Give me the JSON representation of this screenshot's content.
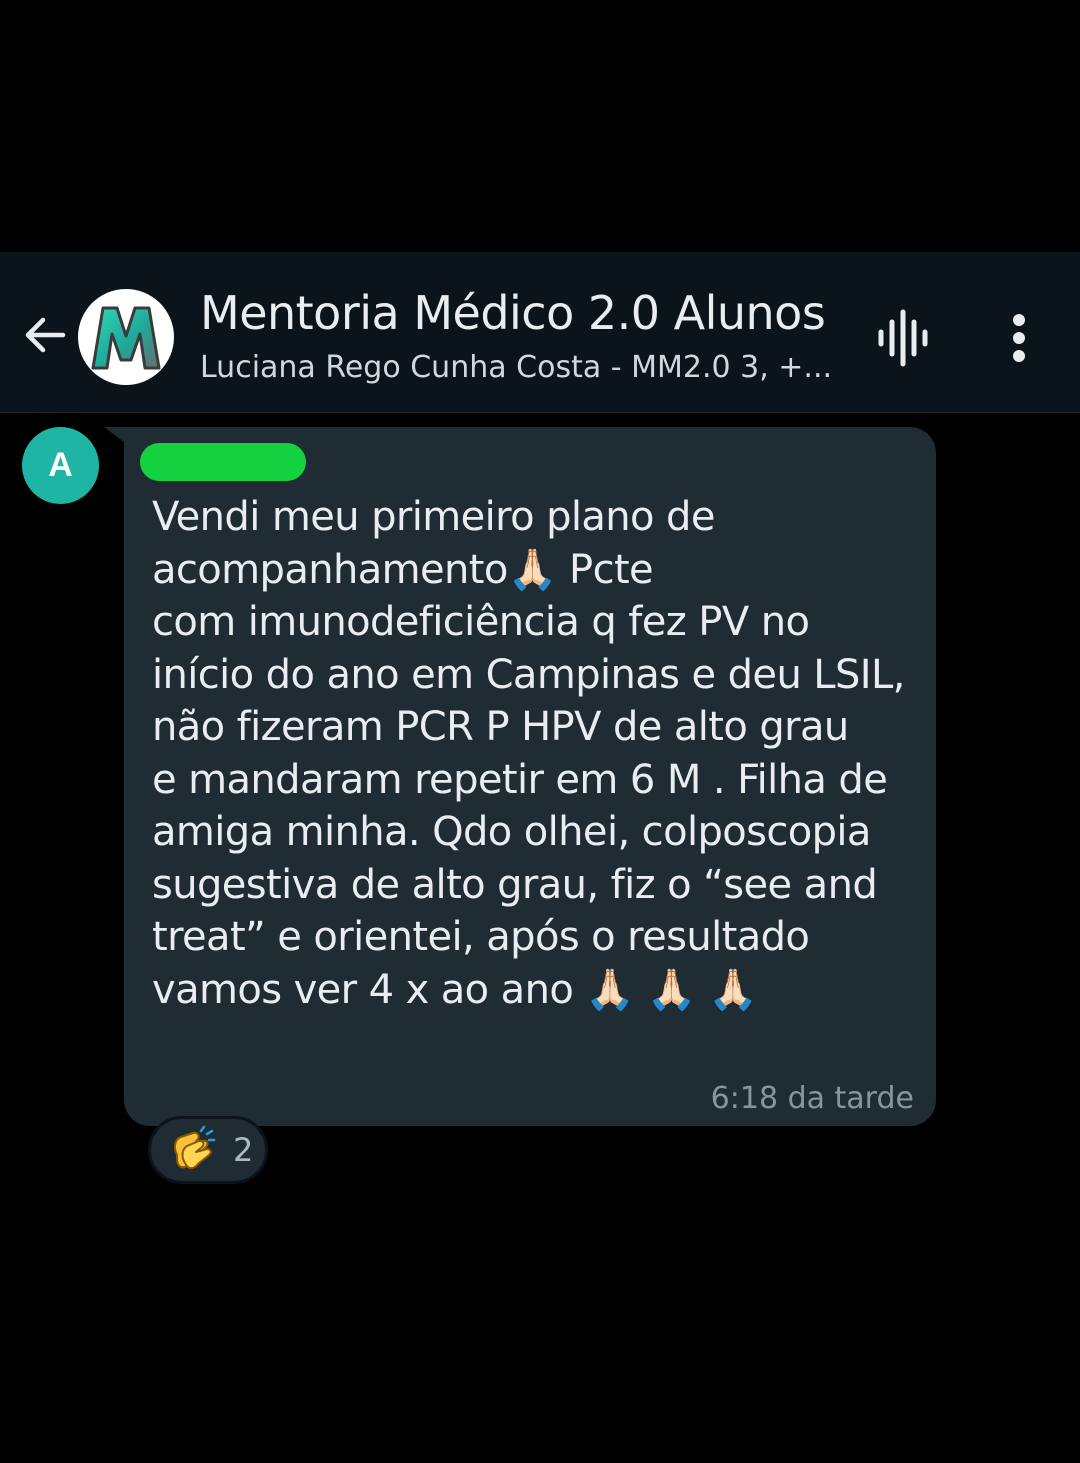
{
  "header": {
    "title": "Mentoria Médico 2.0 Alunos",
    "subtitle": "Luciana Rego Cunha Costa - MM2.0 3, +...",
    "back_icon": "arrow-left-icon",
    "avatar_icon": "m-logo-icon",
    "audio_icon": "audio-wave-icon",
    "menu_icon": "more-vert-icon"
  },
  "message": {
    "sender_initial": "A",
    "text": "Vendi meu primeiro plano de\nacompanhamento🙏🏻 Pcte\ncom imunodeficiência q fez PV no\ninício do ano em Campinas e deu LSIL,\nnão fizeram PCR P HPV de alto grau\ne mandaram repetir em 6 M . Filha de\namiga minha. Qdo olhei, colposcopia\nsugestiva de alto grau, fiz o “see and\ntreat” e orientei, após o resultado\nvamos ver 4 x ao ano 🙏🏻 🙏🏻 🙏🏻",
    "time": "6:18 da tarde"
  },
  "reaction": {
    "emoji": "👏",
    "count": "2"
  },
  "colors": {
    "background": "#000000",
    "header_bg": "#0b141a",
    "bubble_bg": "#1f2c34",
    "avatar_bg": "#1fb5a5",
    "redaction": "#14d13f",
    "text": "#e9edef",
    "meta": "#8696a0"
  }
}
